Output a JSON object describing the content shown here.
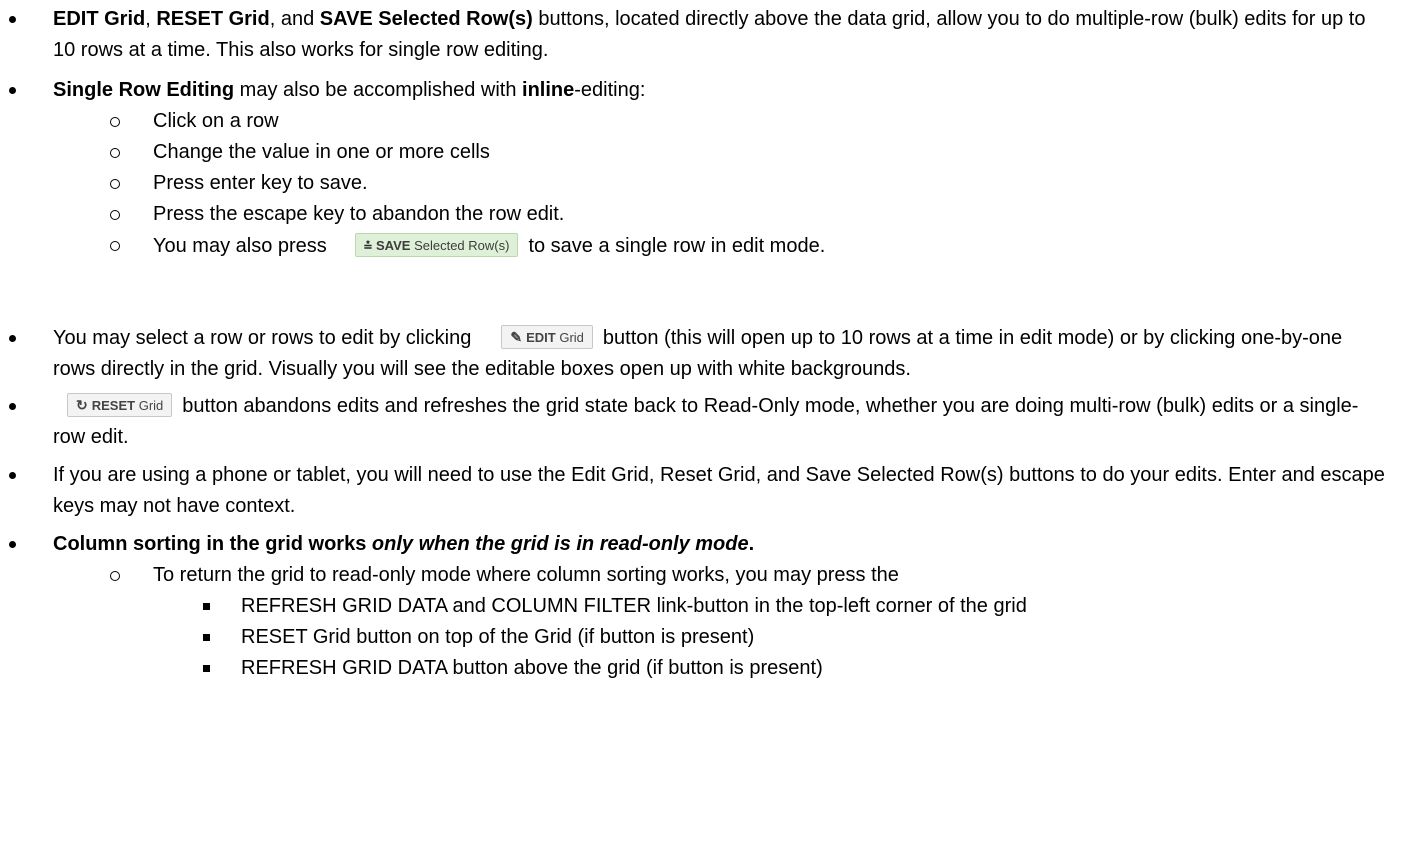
{
  "b1": {
    "t1": "EDIT Grid",
    "t2": ", ",
    "t3": "RESET Grid",
    "t4": ", and ",
    "t5": "SAVE Selected Row(s)",
    "t6": " buttons, located directly above the data grid, allow you to do multiple-row (bulk) edits for up to 10 rows at a time. This also works for single row editing."
  },
  "b2": {
    "t1": "Single Row Editing",
    "t2": " may also be accomplished with ",
    "t3": "inline",
    "t4": "-editing:",
    "subitems": [
      "Click on a row",
      "Change the value in one or more cells",
      "Press enter key to save.",
      "Press the escape key to abandon the row edit."
    ],
    "last_pre": "You may also press",
    "last_post": "to save a single row in edit mode."
  },
  "save_button": {
    "icon": "save-check-icon",
    "strong": "SAVE",
    "label": "Selected Row(s)"
  },
  "b3": {
    "pre": "You may select a row or rows to edit by clicking",
    "post": "button (this will open up to 10 rows at a time in edit mode) or by clicking one-by-one rows directly in the grid. Visually you will see the editable boxes open up with white backgrounds."
  },
  "edit_button": {
    "icon": "edit-icon",
    "strong": "EDIT",
    "label": "Grid"
  },
  "b4": {
    "post": "button abandons edits and refreshes the grid state back to Read-Only mode, whether you are doing multi-row (bulk) edits or a single-row edit."
  },
  "reset_button": {
    "icon": "refresh-icon",
    "strong": "RESET",
    "label": "Grid"
  },
  "b5": {
    "text": "If you are using a phone or tablet, you will need to use the Edit Grid, Reset Grid, and Save Selected Row(s) buttons to do your edits. Enter and escape keys may not have context."
  },
  "b6": {
    "t1": "Column sorting in the grid works ",
    "t2": "only when the grid is in read-only mode",
    "t3": ".",
    "sub": "To return the grid to read-only mode where column sorting works, you may press the",
    "subsub": [
      "REFRESH GRID DATA and COLUMN FILTER link-button in the top-left corner of the grid",
      "RESET Grid button on top of the Grid (if button is present)",
      "REFRESH GRID DATA button above the grid (if button is present)"
    ]
  }
}
